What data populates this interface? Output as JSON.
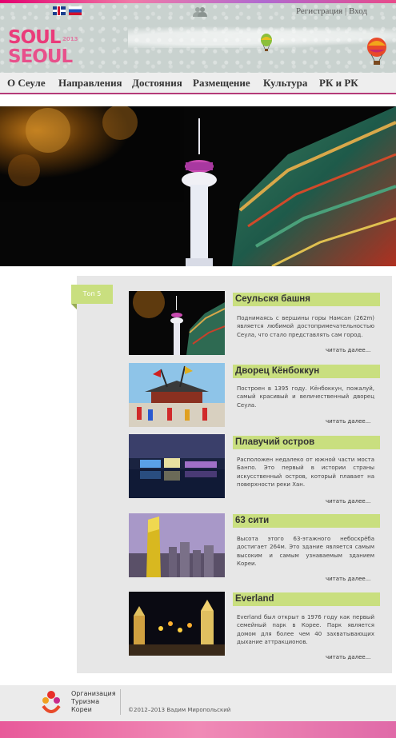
{
  "header": {
    "auth_register": "Регистрация",
    "auth_sep": "|",
    "auth_login": "Вход",
    "logo_line1": "SOUL",
    "logo_line2": "SEOUL",
    "logo_year": "2013",
    "icons": [
      "flag-uk-icon",
      "flag-ru-icon",
      "users-icon",
      "balloon-icon"
    ]
  },
  "nav": {
    "items": [
      {
        "label": "О Сеуле"
      },
      {
        "label": "Направления"
      },
      {
        "label": "Достояния"
      },
      {
        "label": "Размещение"
      },
      {
        "label": "Культура"
      },
      {
        "label": "РК и РК"
      }
    ]
  },
  "section": {
    "badge": "Топ 5",
    "read_more": "читать далее...",
    "items": [
      {
        "title": "Сеульскя башня",
        "text": "Поднимаясь с вершины горы Намсан (262m) является любимой достопримечательностью Сеула, что стало представлять сам город."
      },
      {
        "title": "Дворец Кёнбоккун",
        "text": "Построен в 1395 году. Кёнбоккун, пожалуй, самый красивый и величественный дворец Сеула."
      },
      {
        "title": "Плавучий остров",
        "text": "Расположен недалеко от южной части моста Банпо. Это первый в истории страны искусственный остров, который плавает на поверхности реки Хан."
      },
      {
        "title": "63 сити",
        "text": "Высота этого 63-этажного небоскрёба достигает 264м. Это здание является самым высоким и самым узнаваемым зданием Кореи."
      },
      {
        "title": "Everland",
        "text": "Everland был открыт в 1976 году как первый семейный парк в Корее. Парк является домом для более чем 40 захватывающих дыхание аттракционов."
      }
    ]
  },
  "footer": {
    "org_line1": "Организация",
    "org_line2": "Туризма",
    "org_line3": "Кореи",
    "copyright": "©2012–2013 Вадим Миропольский"
  },
  "colors": {
    "accent_green": "#c9df7f",
    "brand_pink": "#e3006e",
    "nav_underline": "#b43a78"
  }
}
